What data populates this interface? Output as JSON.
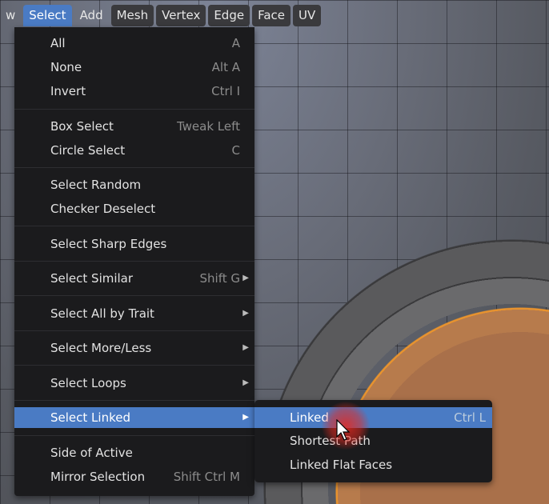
{
  "header": {
    "items": [
      {
        "label": "w",
        "state": "plain"
      },
      {
        "label": "Select",
        "state": "active"
      },
      {
        "label": "Add",
        "state": "plain"
      },
      {
        "label": "Mesh",
        "state": "boxed"
      },
      {
        "label": "Vertex",
        "state": "boxed"
      },
      {
        "label": "Edge",
        "state": "boxed"
      },
      {
        "label": "Face",
        "state": "boxed"
      },
      {
        "label": "UV",
        "state": "boxed"
      }
    ]
  },
  "select_menu": {
    "items": [
      {
        "label": "All",
        "shortcut": "A"
      },
      {
        "label": "None",
        "shortcut": "Alt A"
      },
      {
        "label": "Invert",
        "shortcut": "Ctrl I"
      },
      {
        "label": "Box Select",
        "shortcut": "Tweak Left"
      },
      {
        "label": "Circle Select",
        "shortcut": "C"
      },
      {
        "label": "Select Random",
        "shortcut": ""
      },
      {
        "label": "Checker Deselect",
        "shortcut": ""
      },
      {
        "label": "Select Sharp Edges",
        "shortcut": ""
      },
      {
        "label": "Select Similar",
        "shortcut": "Shift G",
        "submenu": true
      },
      {
        "label": "Select All by Trait",
        "shortcut": "",
        "submenu": true
      },
      {
        "label": "Select More/Less",
        "shortcut": "",
        "submenu": true
      },
      {
        "label": "Select Loops",
        "shortcut": "",
        "submenu": true
      },
      {
        "label": "Select Linked",
        "shortcut": "",
        "submenu": true,
        "highlighted": true
      },
      {
        "label": "Side of Active",
        "shortcut": ""
      },
      {
        "label": "Mirror Selection",
        "shortcut": "Shift Ctrl M"
      }
    ]
  },
  "linked_submenu": {
    "items": [
      {
        "label": "Linked",
        "shortcut": "Ctrl L",
        "highlighted": true
      },
      {
        "label": "Shortest Path",
        "shortcut": ""
      },
      {
        "label": "Linked Flat Faces",
        "shortcut": ""
      }
    ]
  },
  "colors": {
    "accent": "#4a7bc4",
    "menu_bg": "#1b1b1d",
    "selection_orange": "#e8932e"
  }
}
